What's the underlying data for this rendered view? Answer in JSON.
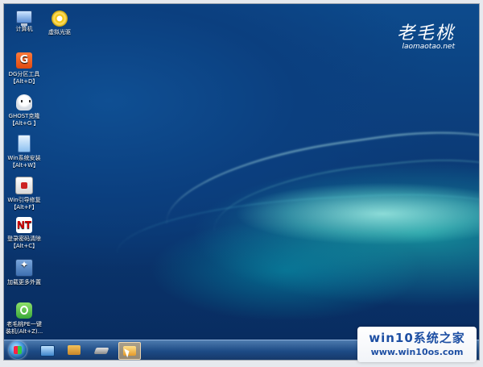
{
  "desktop": {
    "icons": [
      {
        "label": "计算机",
        "sublabel": "",
        "icon": "computer-icon"
      },
      {
        "label": "虚拟光驱",
        "sublabel": "",
        "icon": "virtual-drive-icon"
      },
      {
        "label": "DG分区工具",
        "sublabel": "【Alt+D】",
        "icon": "partition-tool-icon"
      },
      {
        "label": "GHOST克隆",
        "sublabel": "【Alt+G 】",
        "icon": "ghost-icon"
      },
      {
        "label": "Win系统安装",
        "sublabel": "【Alt+W】",
        "icon": "windows-install-icon"
      },
      {
        "label": "Win引导修复",
        "sublabel": "【Alt+F】",
        "icon": "boot-repair-icon"
      },
      {
        "label": "登录密码清除",
        "sublabel": "【Alt+C】",
        "icon": "password-clear-icon"
      },
      {
        "label": "加载更多外置",
        "sublabel": "",
        "icon": "load-more-icon"
      },
      {
        "label": "老毛桃PE一键",
        "sublabel": "装机(Alt+Z)...",
        "icon": "one-click-install-icon"
      }
    ]
  },
  "logo": {
    "brand": "老毛桃",
    "url": "laomaotao.net"
  },
  "watermark": {
    "line1": "win10系统之家",
    "line2": "www.win10os.com"
  },
  "taskbar": {
    "items": [
      "start-button",
      "show-desktop-icon",
      "toolbox-icon",
      "drive-icon",
      "active-app-icon"
    ]
  },
  "colors": {
    "accent": "#1d4fa3",
    "desktop": "#0b3f7f"
  }
}
